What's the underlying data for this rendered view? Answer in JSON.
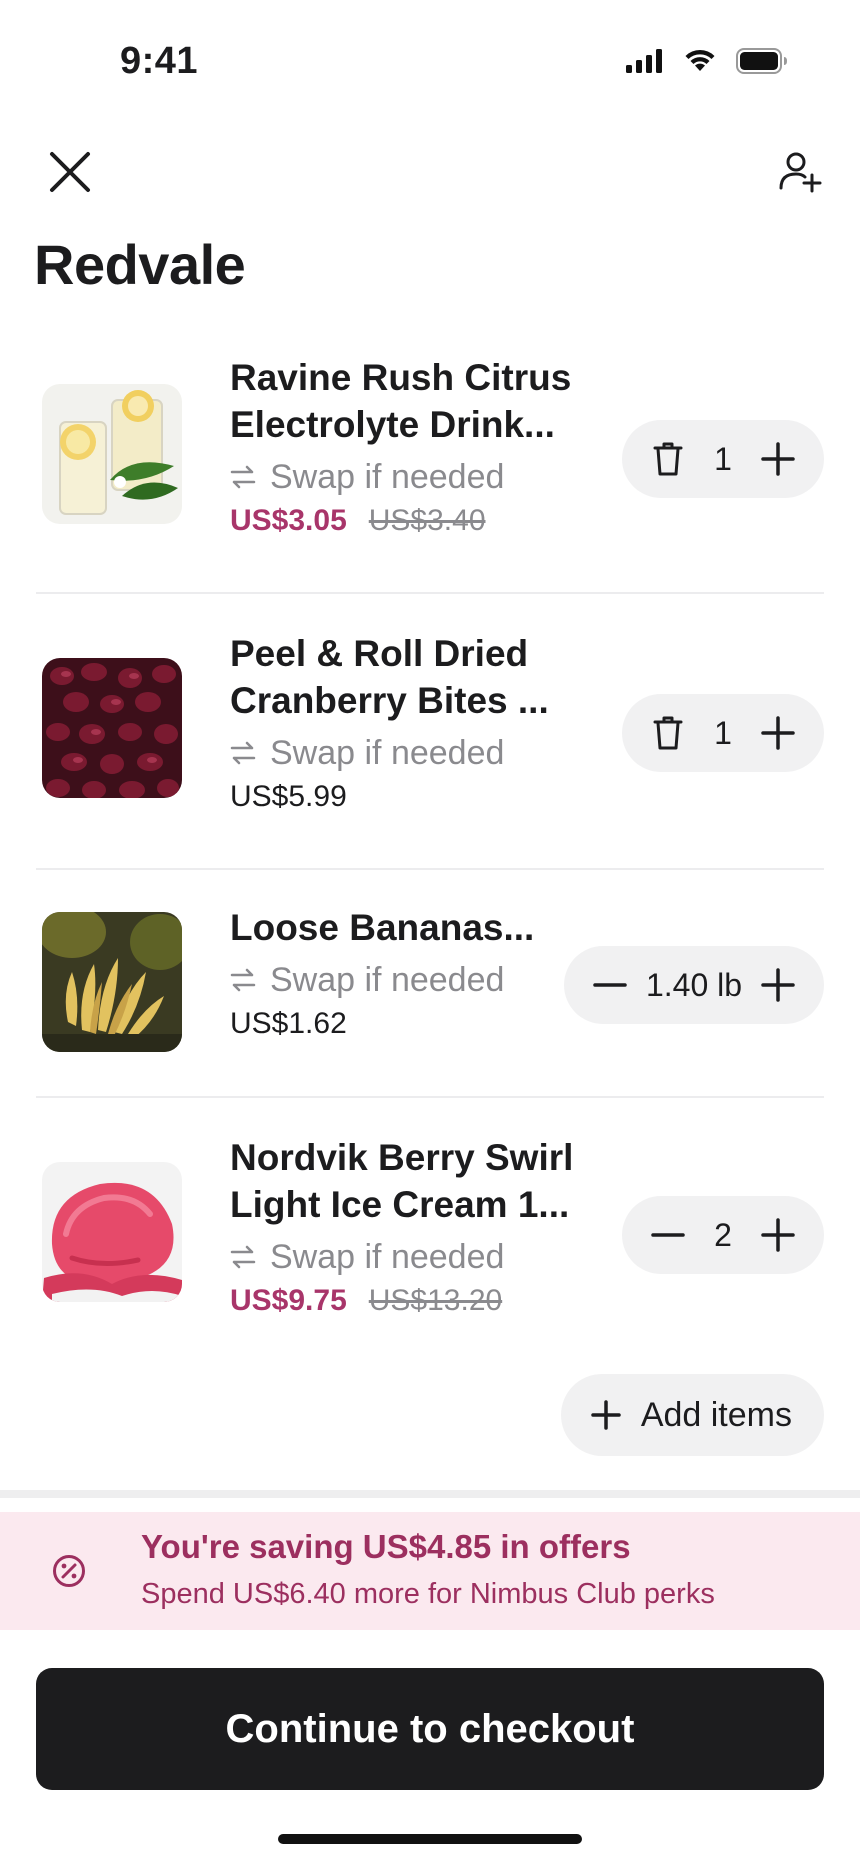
{
  "status_bar": {
    "time": "9:41"
  },
  "store": {
    "name": "Redvale"
  },
  "items": [
    {
      "name_line1": "Ravine Rush Citrus",
      "name_line2": "Electrolyte Drink...",
      "swap_label": "Swap if needed",
      "price": "US$3.05",
      "price_original": "US$3.40",
      "on_sale": true,
      "quantity": "1",
      "thumb": "lemonade-glasses"
    },
    {
      "name_line1": "Peel & Roll Dried",
      "name_line2": "Cranberry Bites ...",
      "swap_label": "Swap if needed",
      "price": "US$5.99",
      "on_sale": false,
      "quantity": "1",
      "thumb": "dried-cranberries"
    },
    {
      "name_line1": "Loose Bananas...",
      "swap_label": "Swap if needed",
      "price": "US$1.62",
      "on_sale": false,
      "quantity": "1.40 lb",
      "thumb": "bananas"
    },
    {
      "name_line1": "Nordvik Berry Swirl",
      "name_line2": "Light Ice Cream 1...",
      "swap_label": "Swap if needed",
      "price": "US$9.75",
      "price_original": "US$13.20",
      "on_sale": true,
      "quantity": "2",
      "thumb": "berry-ice-cream"
    }
  ],
  "add_items": {
    "label": "Add items"
  },
  "offer": {
    "title": "You're saving US$4.85 in offers",
    "subtitle": "Spend US$6.40 more for Nimbus Club perks"
  },
  "checkout": {
    "label": "Continue to checkout"
  },
  "colors": {
    "sale": "#a8356a",
    "offer_bg": "#fbe9ef",
    "offer_text": "#9c2f5f",
    "checkout_bg": "#1c1c1e",
    "stepper_bg": "#f1f1f2"
  },
  "icons": [
    "signal-icon",
    "wifi-icon",
    "battery-icon",
    "close-icon",
    "add-person-icon",
    "swap-icon",
    "trash-icon",
    "minus-icon",
    "plus-icon",
    "discount-icon"
  ]
}
